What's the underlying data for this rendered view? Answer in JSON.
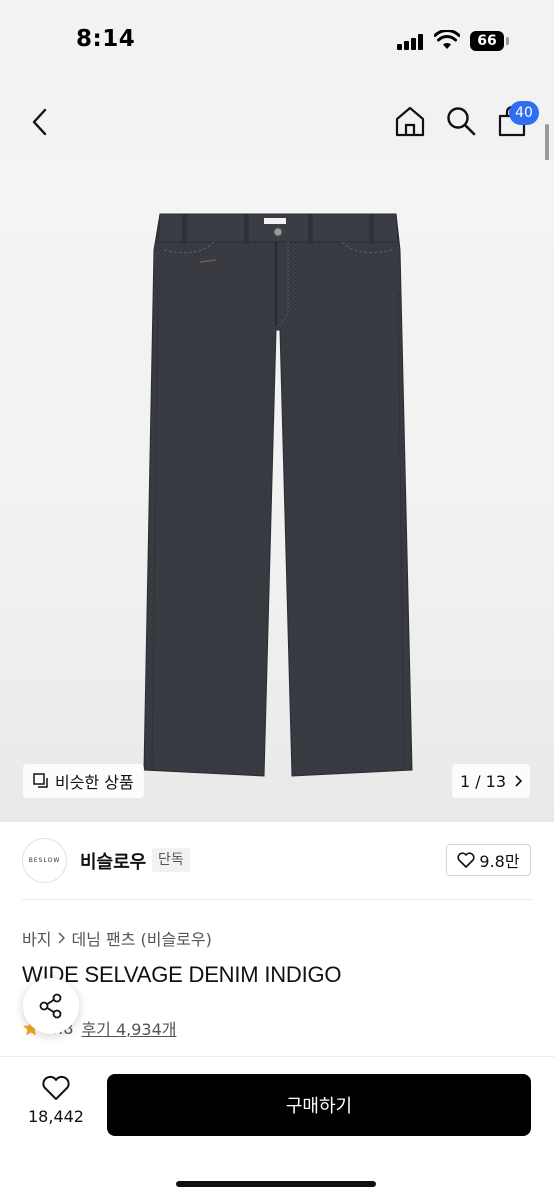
{
  "status_bar": {
    "time": "8:14",
    "battery": "66"
  },
  "nav": {
    "back_icon": "chevron-left-icon",
    "home_icon": "home-icon",
    "search_icon": "search-icon",
    "cart_icon": "shopping-bag-icon",
    "cart_count": "40"
  },
  "gallery": {
    "similar_label": "비슷한 상품",
    "page_indicator": "1 / 13"
  },
  "brand": {
    "logo_text": "BESLOW",
    "name": "비슬로우",
    "tag": "단독",
    "likes": "9.8만"
  },
  "product": {
    "breadcrumb": [
      "바지",
      "데님 팬츠 (비슬로우)"
    ],
    "title": "WIDE SELVAGE DENIM INDIGO",
    "rating": "4.8",
    "reviews": "후기 4,934개"
  },
  "bottom": {
    "wish_count": "18,442",
    "buy_label": "구매하기"
  },
  "colors": {
    "accent": "#2f6ef2",
    "buy_button": "#000000",
    "denim": "#34373d"
  }
}
